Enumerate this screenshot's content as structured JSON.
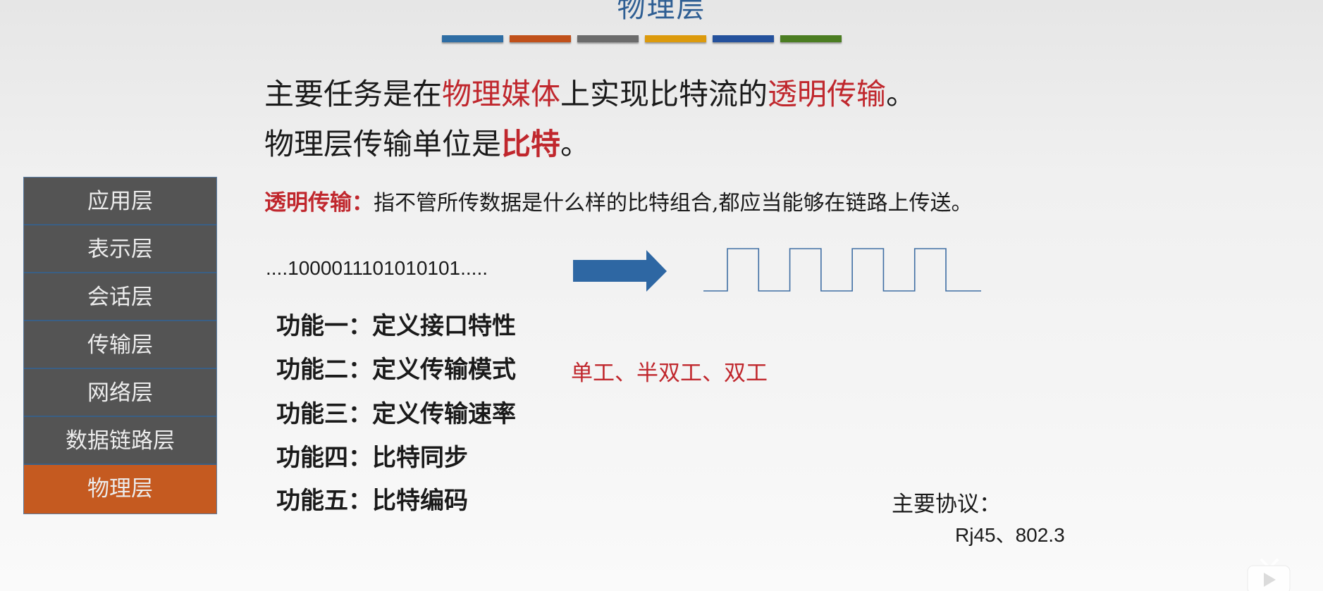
{
  "slide": {
    "title": "物理层",
    "color_bar": [
      "#2e6da4",
      "#c0501a",
      "#6b6b6b",
      "#dc9a0c",
      "#24519c",
      "#4b7d22"
    ],
    "main_task": {
      "p1": "主要任务是在",
      "h1": "物理媒体",
      "p2": "上实现比特流的",
      "h2": "透明传输",
      "p3": "。"
    },
    "unit": {
      "p1": "物理层传输单位是",
      "h1": "比特",
      "p2": "。"
    },
    "definition": {
      "term": "透明传输：",
      "text": "指不管所传数据是什么样的比特组合,都应当能够在链路上传送。"
    },
    "bitstream": "....1000011101010101.....",
    "signal_diagram": {
      "arrow_color": "#2e67a3",
      "wave_color": "#3f6ea3",
      "levels": [
        0,
        1,
        0,
        1,
        0,
        1,
        0,
        1,
        0
      ]
    },
    "functions": [
      {
        "label": "功能一：定义接口特性"
      },
      {
        "label": "功能二：定义传输模式"
      },
      {
        "label": "功能三：定义传输速率"
      },
      {
        "label": "功能四：比特同步"
      },
      {
        "label": "功能五：比特编码"
      }
    ],
    "function_note": "单工、半双工、双工",
    "protocols": {
      "label": "主要协议：",
      "value": "Rj45、802.3"
    },
    "layers": [
      {
        "label": "应用层",
        "active": false
      },
      {
        "label": "表示层",
        "active": false
      },
      {
        "label": "会话层",
        "active": false
      },
      {
        "label": "传输层",
        "active": false
      },
      {
        "label": "网络层",
        "active": false
      },
      {
        "label": "数据链路层",
        "active": false
      },
      {
        "label": "物理层",
        "active": true
      }
    ],
    "colors": {
      "title": "#2e5e93",
      "highlight_red": "#c0272d",
      "layer_bg": "#545454",
      "layer_active_bg": "#c55a20"
    }
  },
  "watermark": {
    "icon": "bilibili-tv-play-icon"
  }
}
